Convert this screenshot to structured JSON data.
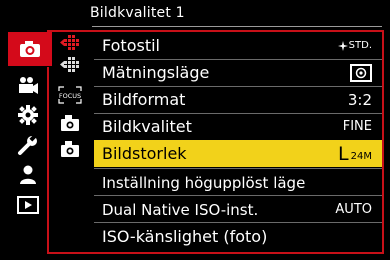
{
  "header": {
    "title": "Bildkvalitet 1"
  },
  "left_menu": [
    {
      "icon": "camera-icon",
      "active": true
    },
    {
      "icon": "video-camera-icon",
      "active": false
    },
    {
      "icon": "gear-icon",
      "active": false
    },
    {
      "icon": "wrench-icon",
      "active": false
    },
    {
      "icon": "person-icon",
      "active": false
    },
    {
      "icon": "playback-icon",
      "active": false
    }
  ],
  "sub_tabs": [
    {
      "icon": "image-quality-icon"
    },
    {
      "icon": "image-quality-2-icon"
    },
    {
      "icon": "focus-icon",
      "text": "FOCUS"
    },
    {
      "icon": "camera-settings-icon"
    },
    {
      "icon": "camera-settings-2-icon"
    }
  ],
  "menu": {
    "items": [
      {
        "label": "Fotostil",
        "value": "STD."
      },
      {
        "label": "Mätningsläge",
        "value": ""
      },
      {
        "label": "Bildformat",
        "value": "3:2"
      },
      {
        "label": "Bildkvalitet",
        "value": "FINE"
      },
      {
        "label": "Bildstorlek",
        "value_main": "L",
        "value_sub": "24M"
      },
      {
        "label": "Inställning högupplöst läge",
        "value": ""
      },
      {
        "label": "Dual Native ISO-inst.",
        "value": "AUTO"
      },
      {
        "label": "ISO-känslighet (foto)",
        "value": ""
      }
    ],
    "selected_index": 4
  },
  "colors": {
    "accent": "#d40a1a",
    "selection": "#f2d21a",
    "background": "#000000"
  }
}
